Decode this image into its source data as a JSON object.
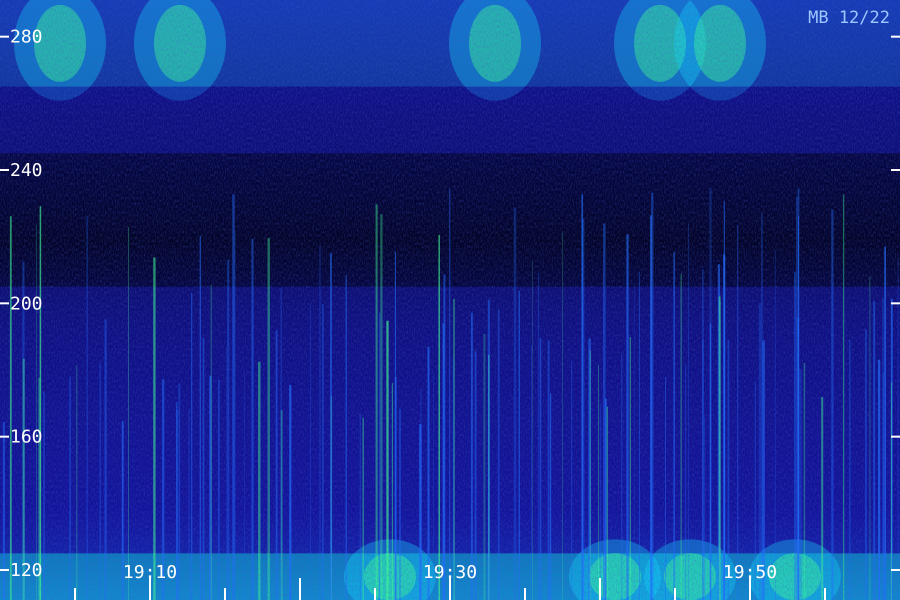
{
  "chart_data": {
    "type": "heatmap",
    "station_label": "MB 12/22",
    "y": {
      "ticks": [
        120,
        160,
        200,
        240,
        280
      ],
      "range": [
        111,
        291
      ]
    },
    "x": {
      "start": "19:00",
      "end": "20:00",
      "labeled_ticks": [
        "19:10",
        "19:30",
        "19:50"
      ],
      "minor_tick_interval_min": 5
    },
    "colormap": [
      "#000000",
      "#0a0a60",
      "#1a1acc",
      "#2070ff",
      "#10e0ff",
      "#40ff90",
      "#a0ff40"
    ],
    "bands": [
      {
        "y_min": 265,
        "y_max": 291,
        "level": "medium-high",
        "peak_times": [
          "19:04",
          "19:12",
          "19:33",
          "19:44",
          "19:48"
        ]
      },
      {
        "y_min": 245,
        "y_max": 265,
        "level": "medium"
      },
      {
        "y_min": 205,
        "y_max": 245,
        "level": "low"
      },
      {
        "y_min": 175,
        "y_max": 205,
        "level": "medium"
      },
      {
        "y_min": 125,
        "y_max": 175,
        "level": "medium",
        "note": "vertical streaks"
      },
      {
        "y_min": 111,
        "y_max": 125,
        "level": "high",
        "peak_times": [
          "19:26",
          "19:41",
          "19:46",
          "19:53"
        ]
      }
    ]
  }
}
